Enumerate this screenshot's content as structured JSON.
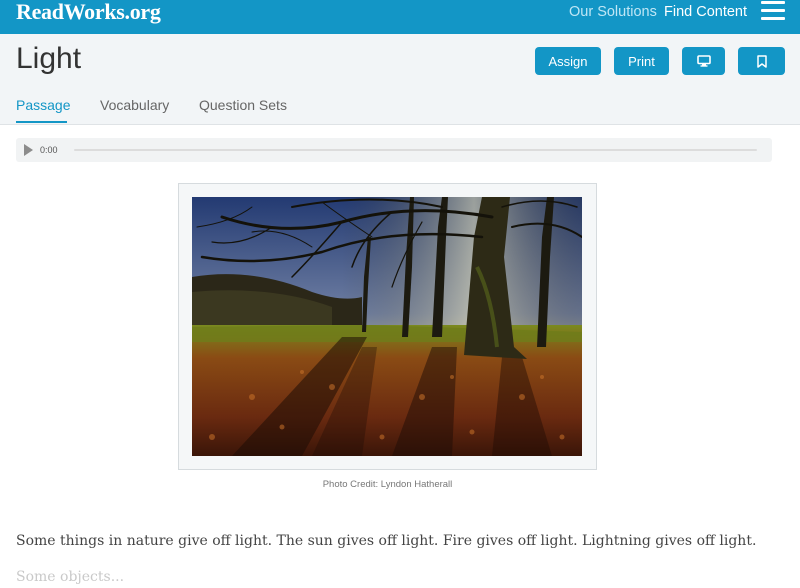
{
  "topbar": {
    "logo": "ReadWorks.org",
    "nav_solutions": "Our Solutions",
    "nav_find": "Find Content"
  },
  "header": {
    "title": "Light",
    "assign_label": "Assign",
    "print_label": "Print",
    "tabs": [
      {
        "label": "Passage",
        "active": true
      },
      {
        "label": "Vocabulary",
        "active": false
      },
      {
        "label": "Question Sets",
        "active": false
      }
    ]
  },
  "audio": {
    "time": "0:00"
  },
  "photo": {
    "credit": "Photo Credit: Lyndon Hatherall"
  },
  "passage": {
    "paragraph": "Some things in nature give off light. The sun gives off light. Fire gives off light. Lightning gives off light.",
    "teaser": "Some objects..."
  },
  "colors": {
    "brand": "#1396c6",
    "header_bg": "#f2f5f7"
  },
  "icons": {
    "menu": "hamburger-icon",
    "present": "monitor-icon",
    "bookmark": "bookmark-icon",
    "play": "play-icon"
  }
}
